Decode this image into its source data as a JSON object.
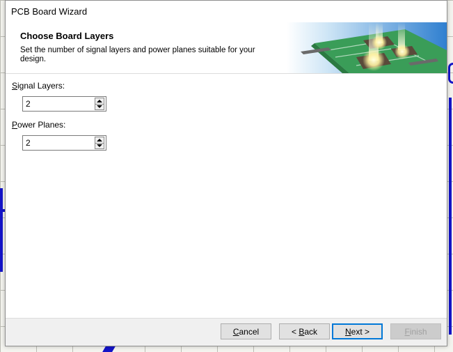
{
  "window": {
    "title": "PCB Board Wizard"
  },
  "header": {
    "title": "Choose Board Layers",
    "description": "Set the number of signal layers and power planes suitable for your design."
  },
  "fields": {
    "signal_layers": {
      "label_accel": "S",
      "label_rest": "ignal Layers:",
      "value": "2"
    },
    "power_planes": {
      "label_accel": "P",
      "label_rest": "ower Planes:",
      "value": "2"
    }
  },
  "buttons": {
    "cancel": {
      "accel": "C",
      "rest": "ancel"
    },
    "back": {
      "prefix": "< ",
      "accel": "B",
      "rest": "ack"
    },
    "next": {
      "accel": "N",
      "rest": "ext >"
    },
    "finish": {
      "accel": "F",
      "rest": "inish"
    }
  },
  "colors": {
    "accent_focus": "#0078d7",
    "background_trace": "#1414c8",
    "pcb_green": "#3a9d58"
  },
  "icons": {
    "header_art": "pcb-chips-illustration",
    "spin_up": "up-triangle",
    "spin_down": "down-triangle"
  }
}
